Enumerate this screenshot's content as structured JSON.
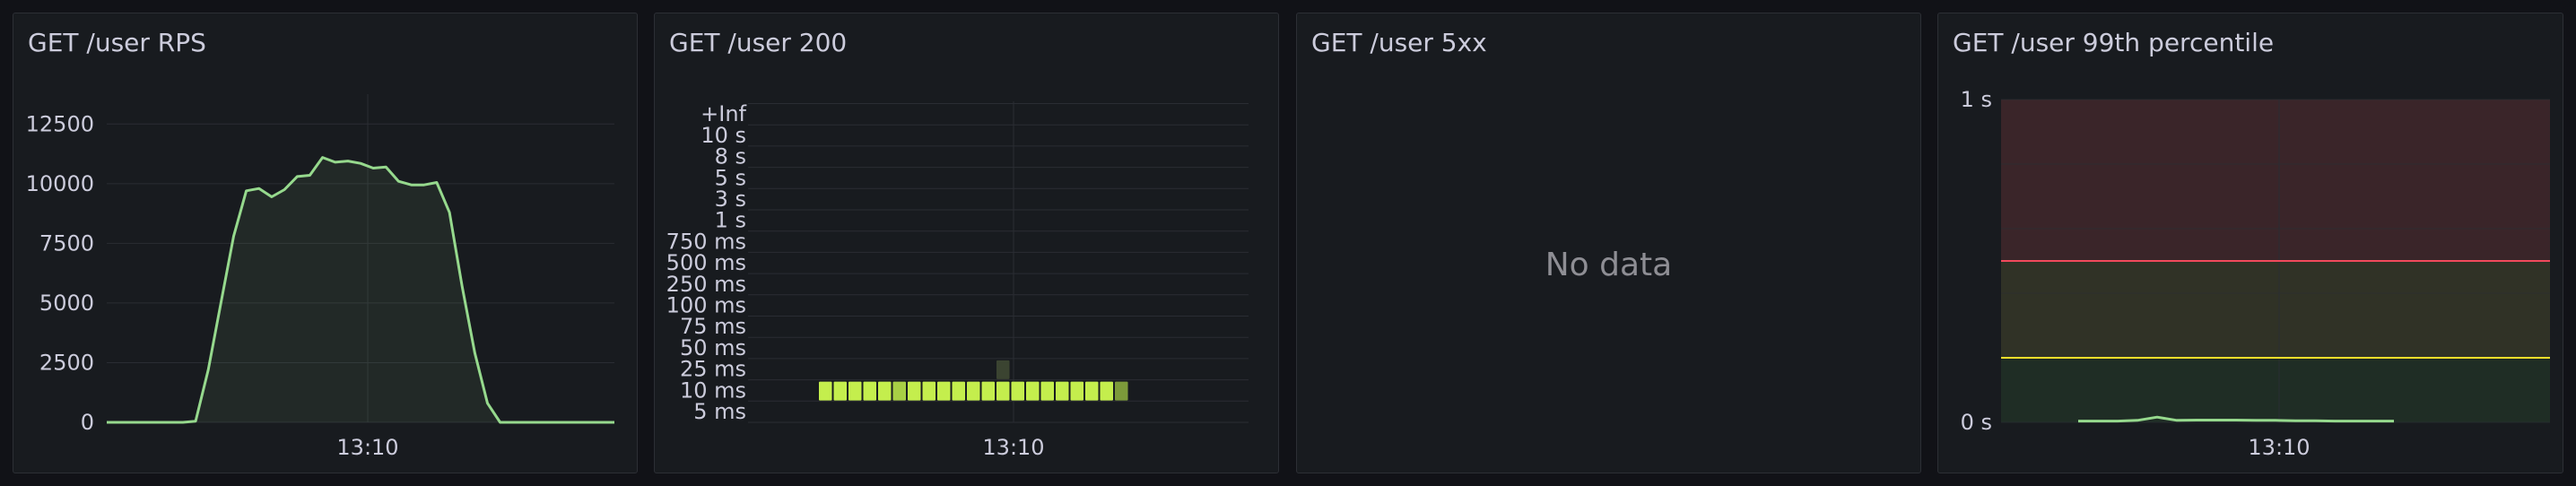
{
  "colors": {
    "background": "#111217",
    "panel_bg": "#181b1f",
    "panel_border": "#2c2f35",
    "text": "#ccccdc",
    "grid": "#2a2d33",
    "series_green": "#96d98d",
    "heat_bright": "#c4ee4d",
    "heat_mid": "#a8cf45",
    "heat_dim": "#7c9a3a",
    "heat_faint": "#3b4431",
    "threshold_red": "#f2495c",
    "threshold_yellow": "#fade2a",
    "zone_red": "#3a2529",
    "zone_yellow": "#303226",
    "zone_green": "#1f2d25",
    "no_data_text": "#8e8e94"
  },
  "panels": {
    "rps": {
      "title": "GET /user RPS",
      "x_tick": "13:10",
      "chart_data": {
        "type": "area",
        "title": "GET /user RPS",
        "xlabel": "",
        "ylabel": "",
        "ylim": [
          0,
          13000
        ],
        "y_ticks": [
          "0",
          "2500",
          "5000",
          "7500",
          "10000",
          "12500"
        ],
        "y_tick_values": [
          0,
          2500,
          5000,
          7500,
          10000,
          12500
        ],
        "grid": true,
        "series": [
          {
            "values": [
              0,
              0,
              0,
              0,
              0,
              0,
              0,
              50,
              2200,
              5000,
              7800,
              9700,
              9800,
              9450,
              9750,
              10300,
              10350,
              11100,
              10900,
              10950,
              10850,
              10650,
              10700,
              10100,
              9950,
              9950,
              10050,
              8800,
              5700,
              2900,
              800,
              0,
              0,
              0,
              0,
              0,
              0,
              0,
              0,
              0,
              0
            ]
          }
        ]
      }
    },
    "status200": {
      "title": "GET /user 200",
      "x_tick": "13:10",
      "chart_data": {
        "type": "heatmap",
        "title": "GET /user 200",
        "xlabel": "",
        "ylabel": "",
        "y_buckets": [
          "5 ms",
          "10 ms",
          "25 ms",
          "50 ms",
          "75 ms",
          "100 ms",
          "250 ms",
          "500 ms",
          "750 ms",
          "1 s",
          "3 s",
          "5 s",
          "8 s",
          "10 s",
          "+Inf"
        ],
        "grid": true,
        "cells": [
          {
            "x": 0,
            "bucket": 1,
            "level": 1.0
          },
          {
            "x": 1,
            "bucket": 1,
            "level": 1.0
          },
          {
            "x": 2,
            "bucket": 1,
            "level": 1.0
          },
          {
            "x": 3,
            "bucket": 1,
            "level": 1.0
          },
          {
            "x": 4,
            "bucket": 1,
            "level": 1.0
          },
          {
            "x": 5,
            "bucket": 1,
            "level": 0.85
          },
          {
            "x": 6,
            "bucket": 1,
            "level": 1.0
          },
          {
            "x": 7,
            "bucket": 1,
            "level": 1.0
          },
          {
            "x": 8,
            "bucket": 1,
            "level": 1.0
          },
          {
            "x": 9,
            "bucket": 1,
            "level": 1.0
          },
          {
            "x": 10,
            "bucket": 1,
            "level": 1.0
          },
          {
            "x": 11,
            "bucket": 1,
            "level": 1.0
          },
          {
            "x": 12,
            "bucket": 1,
            "level": 1.0
          },
          {
            "x": 13,
            "bucket": 1,
            "level": 1.0
          },
          {
            "x": 14,
            "bucket": 1,
            "level": 1.0
          },
          {
            "x": 15,
            "bucket": 1,
            "level": 1.0
          },
          {
            "x": 16,
            "bucket": 1,
            "level": 1.0
          },
          {
            "x": 17,
            "bucket": 1,
            "level": 1.0
          },
          {
            "x": 18,
            "bucket": 1,
            "level": 1.0
          },
          {
            "x": 19,
            "bucket": 1,
            "level": 1.0
          },
          {
            "x": 20,
            "bucket": 1,
            "level": 0.55
          },
          {
            "x": 12,
            "bucket": 2,
            "level": 0.2
          }
        ],
        "x_count": 21
      }
    },
    "status5xx": {
      "title": "GET /user 5xx",
      "no_data": "No data"
    },
    "p99": {
      "title": "GET /user 99th percentile",
      "x_tick": "13:10",
      "chart_data": {
        "type": "line",
        "title": "GET /user 99th percentile",
        "xlabel": "",
        "ylabel": "",
        "ylim": [
          0,
          1
        ],
        "y_ticks": [
          "0 s",
          "1 s"
        ],
        "y_tick_values": [
          0,
          1
        ],
        "grid": true,
        "thresholds": [
          {
            "value": 0.2,
            "color": "yellow"
          },
          {
            "value": 0.5,
            "color": "red"
          }
        ],
        "series": [
          {
            "values": [
              0.004,
              0.004,
              0.004,
              0.006,
              0.016,
              0.006,
              0.007,
              0.007,
              0.007,
              0.006,
              0.006,
              0.005,
              0.005,
              0.004,
              0.004,
              0.004,
              0.004
            ]
          }
        ]
      }
    }
  }
}
